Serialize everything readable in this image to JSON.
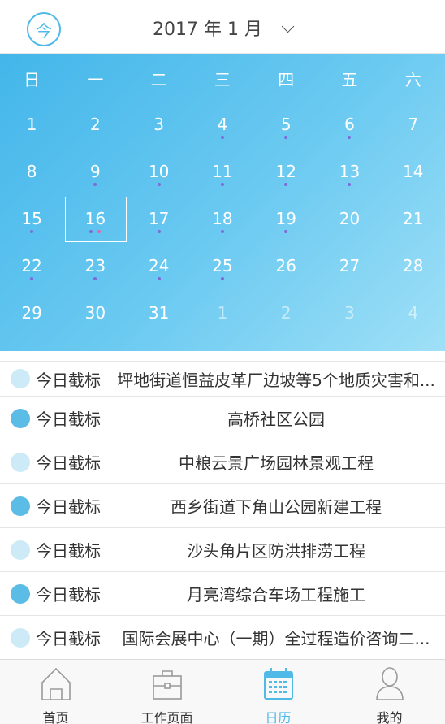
{
  "header": {
    "today_label": "今",
    "month_title": "2017 年 1 月"
  },
  "colors": {
    "accent": "#4fb9e8",
    "calendar_gradient_start": "#43b6ea",
    "calendar_gradient_end": "#9fe0f7",
    "event_dot": "#7d6bd6",
    "event_dot_alt": "#e06aa5"
  },
  "calendar": {
    "weekdays": [
      "日",
      "一",
      "二",
      "三",
      "四",
      "五",
      "六"
    ],
    "weeks": [
      [
        {
          "d": "1"
        },
        {
          "d": "2"
        },
        {
          "d": "3"
        },
        {
          "d": "4",
          "dots": [
            "p"
          ]
        },
        {
          "d": "5",
          "dots": [
            "p"
          ]
        },
        {
          "d": "6",
          "dots": [
            "p"
          ]
        },
        {
          "d": "7"
        }
      ],
      [
        {
          "d": "8"
        },
        {
          "d": "9",
          "dots": [
            "p"
          ]
        },
        {
          "d": "10",
          "dots": [
            "p"
          ]
        },
        {
          "d": "11",
          "dots": [
            "p"
          ]
        },
        {
          "d": "12",
          "dots": [
            "p"
          ]
        },
        {
          "d": "13",
          "dots": [
            "p"
          ]
        },
        {
          "d": "14"
        }
      ],
      [
        {
          "d": "15",
          "dots": [
            "p"
          ]
        },
        {
          "d": "16",
          "selected": true,
          "dots": [
            "p",
            "k"
          ]
        },
        {
          "d": "17",
          "dots": [
            "p"
          ]
        },
        {
          "d": "18",
          "dots": [
            "p"
          ]
        },
        {
          "d": "19",
          "dots": [
            "p"
          ]
        },
        {
          "d": "20"
        },
        {
          "d": "21"
        }
      ],
      [
        {
          "d": "22",
          "dots": [
            "p"
          ]
        },
        {
          "d": "23",
          "dots": [
            "p"
          ]
        },
        {
          "d": "24",
          "dots": [
            "p"
          ]
        },
        {
          "d": "25",
          "dots": [
            "p"
          ]
        },
        {
          "d": "26"
        },
        {
          "d": "27"
        },
        {
          "d": "28"
        }
      ],
      [
        {
          "d": "29"
        },
        {
          "d": "30"
        },
        {
          "d": "31"
        },
        {
          "d": "1",
          "other": true
        },
        {
          "d": "2",
          "other": true
        },
        {
          "d": "3",
          "other": true
        },
        {
          "d": "4",
          "other": true
        }
      ]
    ]
  },
  "list": {
    "items": [
      {
        "tag": "今日截标",
        "title": "坪地街道恒益皮革厂边坡等5个地质灾害和...",
        "style": "light"
      },
      {
        "tag": "今日截标",
        "title": "高桥社区公园",
        "style": "dark"
      },
      {
        "tag": "今日截标",
        "title": "中粮云景广场园林景观工程",
        "style": "light"
      },
      {
        "tag": "今日截标",
        "title": "西乡街道下角山公园新建工程",
        "style": "dark"
      },
      {
        "tag": "今日截标",
        "title": "沙头角片区防洪排涝工程",
        "style": "light"
      },
      {
        "tag": "今日截标",
        "title": "月亮湾综合车场工程施工",
        "style": "dark"
      },
      {
        "tag": "今日截标",
        "title": "国际会展中心（一期）全过程造价咨询二...",
        "style": "light"
      }
    ]
  },
  "tabbar": {
    "tabs": [
      {
        "label": "首页",
        "icon": "home-icon"
      },
      {
        "label": "工作页面",
        "icon": "briefcase-icon"
      },
      {
        "label": "日历",
        "icon": "calendar-icon",
        "active": true
      },
      {
        "label": "我的",
        "icon": "user-icon"
      }
    ]
  }
}
